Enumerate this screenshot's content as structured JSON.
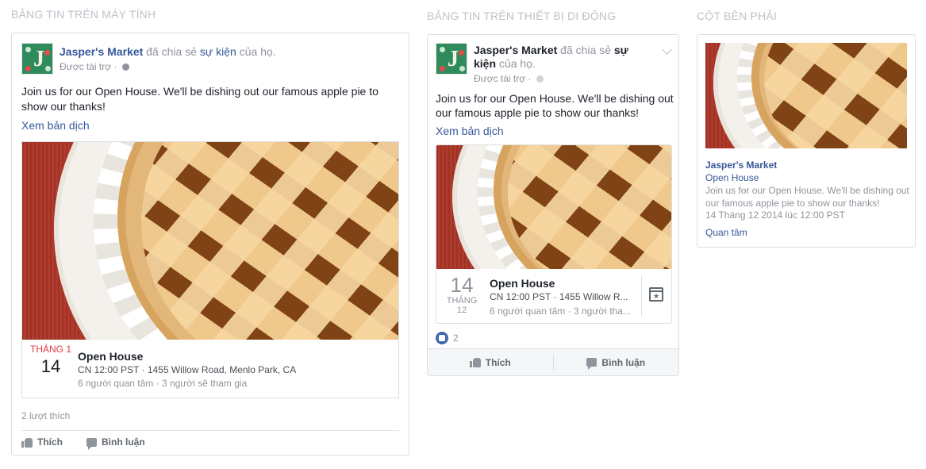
{
  "sections": {
    "desktop": "BẢNG TIN TRÊN MÁY TÍNH",
    "mobile": "BẢNG TIN TRÊN THIẾT BỊ DI ĐỘNG",
    "right": "CỘT BÊN PHẢI"
  },
  "post": {
    "page_name": "Jasper's Market",
    "shared_text": "đã chia sẻ",
    "event_word": "sự kiện",
    "of_them": "của họ.",
    "sponsored": "Được tài trợ",
    "dot": "·",
    "message": "Join us for our Open House. We'll be dishing out our famous apple pie to show our thanks!",
    "translate": "Xem bản dịch"
  },
  "event": {
    "month": "THÁNG 1",
    "day": "14",
    "name": "Open House",
    "details": "CN 12:00 PST · 1455 Willow Road, Menlo Park, CA",
    "details_mobile": "CN 12:00 PST · 1455 Willow R...",
    "counts": "6 người quan tâm · 3 người sẽ tham gia",
    "counts_mobile": "6 người quan tâm · 3 người tha...",
    "mobile_month": "THÁNG",
    "mobile_month_num": "12"
  },
  "desktop": {
    "likes": "2 lượt thích",
    "like": "Thích",
    "comment": "Bình luận"
  },
  "mobile": {
    "like_count": "2",
    "like": "Thích",
    "comment": "Bình luận"
  },
  "right_column": {
    "page_name": "Jasper's Market",
    "event_name": "Open House",
    "message": "Join us for our Open House. We'll be dishing out our famous apple pie to show our thanks!",
    "date": "14 Tháng 12 2014 lúc 12:00 PST",
    "interested": "Quan tâm"
  },
  "colors": {
    "link": "#365899",
    "muted": "#90949c",
    "month_red": "#e0393e",
    "border": "#dddfe2",
    "like_blue": "#4267b2"
  }
}
